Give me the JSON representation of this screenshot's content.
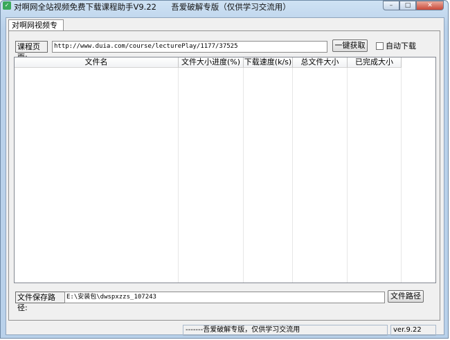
{
  "window": {
    "title": "对啊网全站视频免费下载课程助手V9.22",
    "subtitle": "吾爱破解专版（仅供学习交流用）",
    "icon": "app-icon",
    "min_symbol": "–",
    "max_symbol": "□",
    "close_symbol": "✕"
  },
  "tab": {
    "label": "对啊网视频专下"
  },
  "course": {
    "label": "课程页面:",
    "url": "http://www.duia.com/course/lecturePlay/1177/37525",
    "fetch_button": "一键获取",
    "auto_download_label": "自动下载",
    "auto_download_checked": false
  },
  "list": {
    "columns": [
      "文件名",
      "文件大小",
      "进度(%)",
      "下载速度(k/s)",
      "总文件大小",
      "已完成大小"
    ],
    "rows": []
  },
  "save": {
    "label": "文件保存路径:",
    "path": "E:\\安装包\\dwspxzzs_107243",
    "button": "文件路径"
  },
  "status": {
    "message": "-------吾爱破解专版，仅供学习交流用",
    "version": "ver.9.22"
  }
}
